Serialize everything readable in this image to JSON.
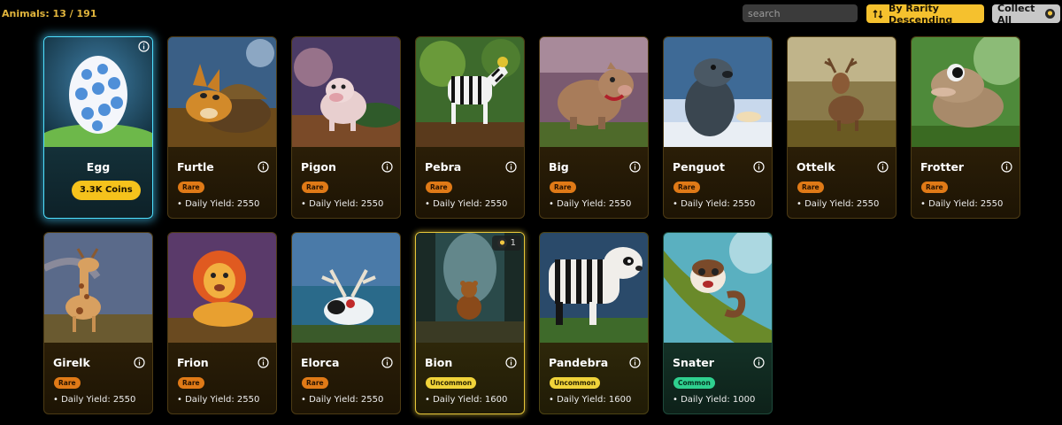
{
  "header": {
    "count_text": "Animals: 13 / 191",
    "search_placeholder": "search",
    "sort_label": "By Rarity Descending",
    "collect_label": "Collect All"
  },
  "egg": {
    "name": "Egg",
    "price": "3.3K Coins"
  },
  "animals": [
    {
      "name": "Furtle",
      "rarity": "Rare",
      "yield": "• Daily Yield: 2550",
      "art": "turtle-fox"
    },
    {
      "name": "Pigon",
      "rarity": "Rare",
      "yield": "• Daily Yield: 2550",
      "art": "pig"
    },
    {
      "name": "Pebra",
      "rarity": "Rare",
      "yield": "• Daily Yield: 2550",
      "art": "zebra"
    },
    {
      "name": "Big",
      "rarity": "Rare",
      "yield": "• Daily Yield: 2550",
      "art": "bear-pig"
    },
    {
      "name": "Penguot",
      "rarity": "Rare",
      "yield": "• Daily Yield: 2550",
      "art": "seal-penguin"
    },
    {
      "name": "Ottelk",
      "rarity": "Rare",
      "yield": "• Daily Yield: 2550",
      "art": "elk"
    },
    {
      "name": "Frotter",
      "rarity": "Rare",
      "yield": "• Daily Yield: 2550",
      "art": "frog-otter"
    },
    {
      "name": "Girelk",
      "rarity": "Rare",
      "yield": "• Daily Yield: 2550",
      "art": "giraffe"
    },
    {
      "name": "Frion",
      "rarity": "Rare",
      "yield": "• Daily Yield: 2550",
      "art": "lion"
    },
    {
      "name": "Elorca",
      "rarity": "Rare",
      "yield": "• Daily Yield: 2550",
      "art": "orca-elk"
    },
    {
      "name": "Bion",
      "rarity": "Uncommon",
      "yield": "• Daily Yield: 1600",
      "art": "bear-cub",
      "owned": "1"
    },
    {
      "name": "Pandebra",
      "rarity": "Uncommon",
      "yield": "• Daily Yield: 1600",
      "art": "panda-zebra"
    },
    {
      "name": "Snater",
      "rarity": "Common",
      "yield": "• Daily Yield: 1000",
      "art": "snake-otter"
    }
  ],
  "colors": {
    "accent": "#f5c12e",
    "rare": "#e07a17",
    "uncommon": "#f0d33a",
    "common": "#2fd08f",
    "egg_glow": "#4ee0ff"
  },
  "icons": {
    "sort": "sort-arrows-icon",
    "collect": "coin-icon",
    "info": "info-icon"
  }
}
